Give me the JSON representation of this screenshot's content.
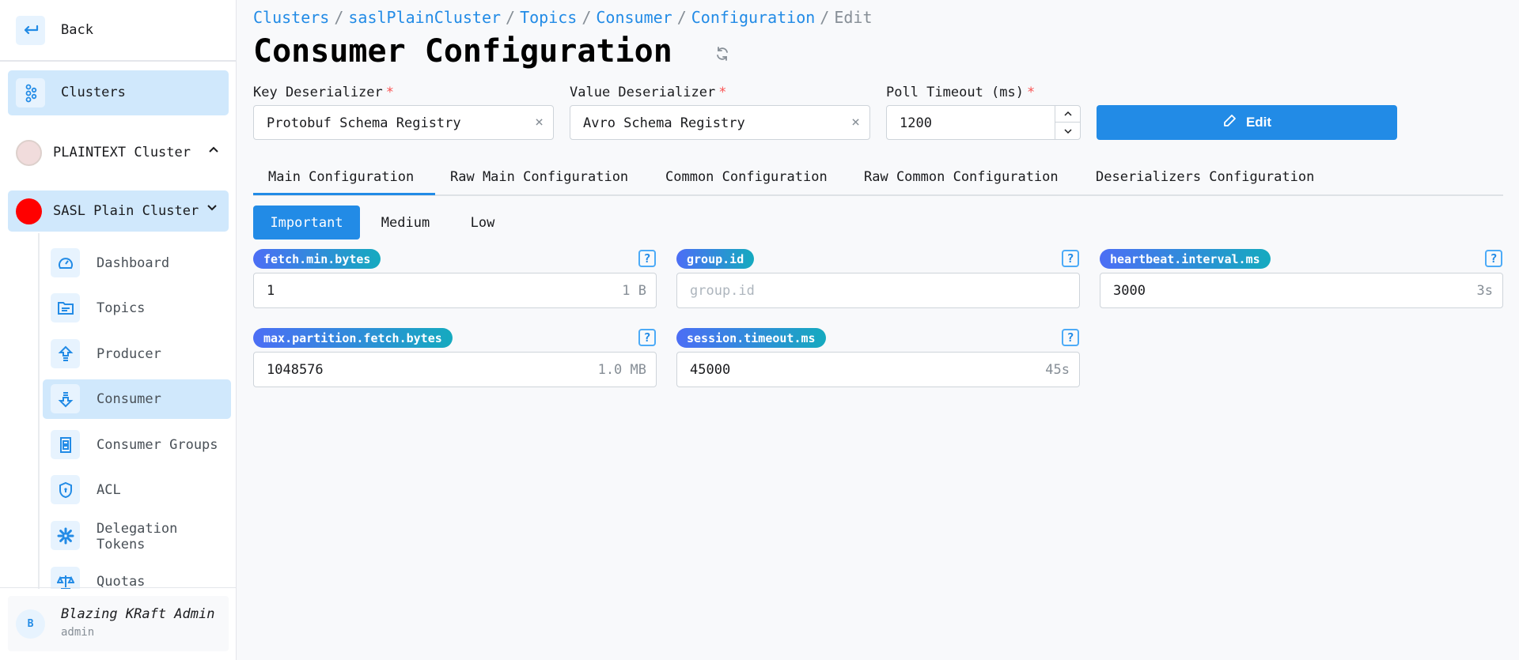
{
  "sidebar": {
    "back_label": "Back",
    "clusters_label": "Clusters",
    "clusters_list": [
      {
        "label": "PLAINTEXT Cluster",
        "color": "#f1dcdc",
        "expanded": false,
        "chevron": "^"
      },
      {
        "label": "SASL Plain Cluster",
        "color": "#ff0000",
        "expanded": true,
        "chevron": "⌄"
      }
    ],
    "sub_items": [
      {
        "label": "Dashboard",
        "icon": "gauge-icon"
      },
      {
        "label": "Topics",
        "icon": "folder-icon"
      },
      {
        "label": "Producer",
        "icon": "upload-arrow-icon"
      },
      {
        "label": "Consumer",
        "icon": "download-arrow-icon",
        "active": true
      },
      {
        "label": "Consumer Groups",
        "icon": "group-box-icon"
      },
      {
        "label": "ACL",
        "icon": "shield-icon"
      },
      {
        "label": "Delegation Tokens",
        "icon": "asterisk-icon"
      },
      {
        "label": "Quotas",
        "icon": "scale-icon"
      }
    ],
    "user": {
      "initial": "B",
      "name": "Blazing KRaft Admin",
      "role": "admin"
    }
  },
  "breadcrumb": {
    "items": [
      "Clusters",
      "saslPlainCluster",
      "Topics",
      "Consumer",
      "Configuration"
    ],
    "current": "Edit",
    "separator": "/"
  },
  "page": {
    "title": "Consumer Configuration"
  },
  "form": {
    "key_deserializer": {
      "label": "Key Deserializer",
      "required_mark": "*",
      "value": "Protobuf Schema Registry"
    },
    "value_deserializer": {
      "label": "Value Deserializer",
      "required_mark": "*",
      "value": "Avro Schema Registry"
    },
    "poll_timeout": {
      "label": "Poll Timeout (ms)",
      "required_mark": "*",
      "value": "1200"
    },
    "edit_button": "Edit"
  },
  "tabs": [
    "Main Configuration",
    "Raw Main Configuration",
    "Common Configuration",
    "Raw Common Configuration",
    "Deserializers Configuration"
  ],
  "active_tab": "Main Configuration",
  "importance": {
    "options": [
      "Important",
      "Medium",
      "Low"
    ],
    "selected": "Important"
  },
  "configs": [
    {
      "key": "fetch.min.bytes",
      "value": "1",
      "placeholder": "",
      "unit": "1 B"
    },
    {
      "key": "group.id",
      "value": "",
      "placeholder": "group.id",
      "unit": ""
    },
    {
      "key": "heartbeat.interval.ms",
      "value": "3000",
      "placeholder": "",
      "unit": "3s"
    },
    {
      "key": "max.partition.fetch.bytes",
      "value": "1048576",
      "placeholder": "",
      "unit": "1.0 MB"
    },
    {
      "key": "session.timeout.ms",
      "value": "45000",
      "placeholder": "",
      "unit": "45s"
    }
  ],
  "help_glyph": "?",
  "clear_glyph": "×",
  "colors": {
    "accent": "#228be6",
    "active_bg": "#d0e8fc",
    "required": "#fa5252"
  }
}
